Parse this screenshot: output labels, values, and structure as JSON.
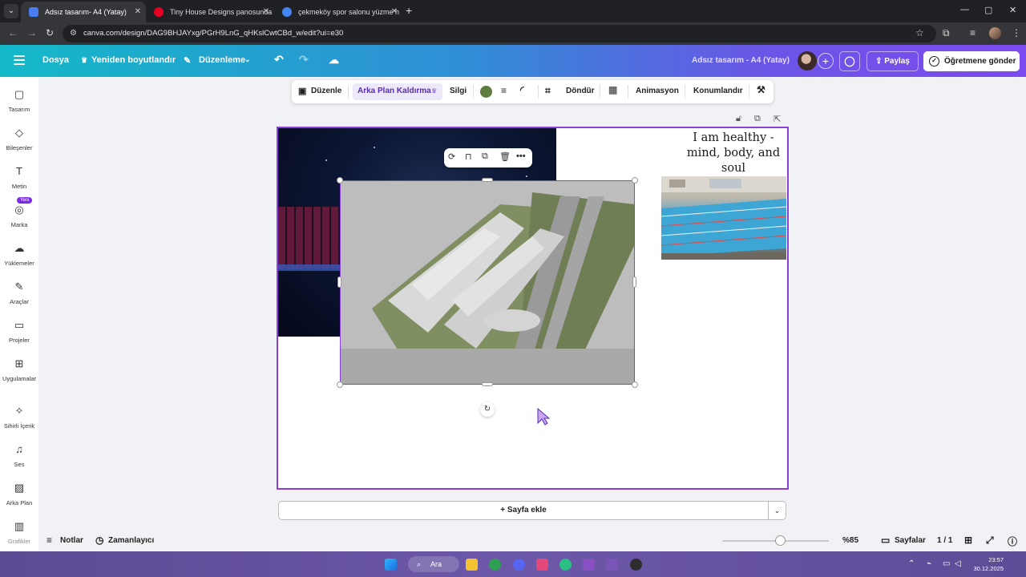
{
  "browser": {
    "tabs": [
      {
        "title": "Adsız tasarım- A4 (Yatay)",
        "active": true,
        "favicon_color": "#4a7df0"
      },
      {
        "title": "Tiny House Designs panosunda",
        "active": false,
        "favicon_color": "#e60023"
      },
      {
        "title": "çekmeköy spor salonu yüzme h",
        "active": false,
        "favicon_color": "#4285f4"
      }
    ],
    "new_tab": "+",
    "url": "canva.com/design/DAG9BHJAYxg/PGrH9LnG_qHKslCwtCBd_w/edit?ui=e30",
    "window_controls": {
      "minimize": "—",
      "maximize": "▢",
      "close": "✕"
    }
  },
  "header": {
    "menu": "Dosya",
    "resize": "Yeniden boyutlandır",
    "edit": "Düzenleme",
    "doc_title": "Adsız tasarım - A4 (Yatay)",
    "share": "Paylaş",
    "send": "Öğretmene gönder"
  },
  "sidebar": {
    "items": [
      {
        "label": "Tasarım",
        "icon": "layout-icon"
      },
      {
        "label": "Bileşenler",
        "icon": "elements-icon"
      },
      {
        "label": "Metin",
        "icon": "text-icon"
      },
      {
        "label": "Marka",
        "icon": "brand-icon"
      },
      {
        "label": "Yüklemeler",
        "icon": "upload-icon"
      },
      {
        "label": "Araçlar",
        "icon": "pen-icon"
      },
      {
        "label": "Projeler",
        "icon": "folder-icon"
      },
      {
        "label": "Uygulamalar",
        "icon": "apps-icon"
      },
      {
        "label": "Sihirli İçerik",
        "icon": "magic-icon"
      },
      {
        "label": "Ses",
        "icon": "music-icon"
      },
      {
        "label": "Arka Plan",
        "icon": "background-icon"
      },
      {
        "label": "Grafikler",
        "icon": "charts-icon"
      }
    ],
    "new_badge": "Yeni"
  },
  "toolbar": {
    "edit": "Düzenle",
    "bg_remove": "Arka Plan Kaldırma",
    "eraser": "Silgi",
    "swatch_color": "#5e7c40",
    "rotate": "Döndür",
    "animate": "Animasyon",
    "position": "Konumlandır"
  },
  "canvas": {
    "quote": "I am healthy - mind, body, and soul",
    "selection_border_color": "#8b3fd9"
  },
  "add_page": "+ Sayfa ekle",
  "bottom": {
    "notes": "Notlar",
    "timer": "Zamanlayıcı",
    "zoom": "%85",
    "pages": "Sayfalar",
    "page_count": "1 / 1"
  },
  "taskbar": {
    "search": "Ara",
    "time": "23:57",
    "date": "30.12.2025"
  }
}
